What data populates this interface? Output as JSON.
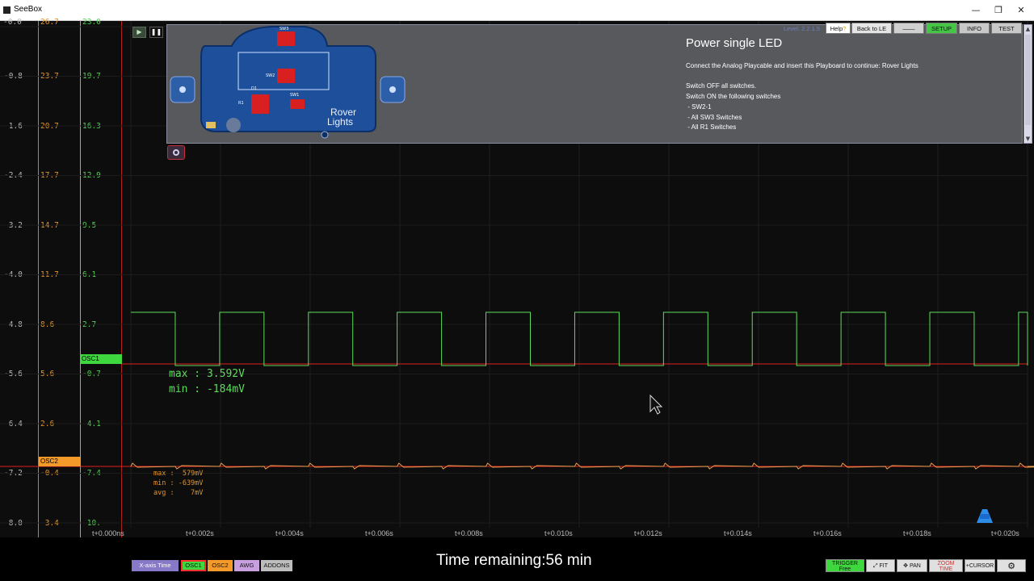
{
  "window": {
    "title": "SeeBox",
    "controls": [
      "—",
      "❐",
      "✕"
    ]
  },
  "axes": {
    "col1": [
      "-0.8",
      "-1.6",
      "-2.4",
      "-3.2",
      "-4.0",
      "-4.8",
      "-5.6",
      "-6.4",
      "-7.2",
      "-8.0"
    ],
    "col2": [
      "23.7",
      "20.7",
      "17.7",
      "14.7",
      "11.7",
      "8.6",
      "5.6",
      "2.6",
      "-0.4",
      "-3.4"
    ],
    "col3": [
      "19.7",
      "16.3",
      "12.9",
      "9.5",
      "6.1",
      "2.7",
      "-0.7",
      "-4.1",
      "-7.4",
      "-10."
    ],
    "top_partial": {
      "col1": "-0.0",
      "col2": "26.7",
      "col3": "23.0"
    },
    "x_ticks": [
      "t+0.000ns",
      "t+0.002s",
      "t+0.004s",
      "t+0.006s",
      "t+0.008s",
      "t+0.010s",
      "t+0.012s",
      "t+0.014s",
      "t+0.016s",
      "t+0.018s",
      "t+0.020s"
    ]
  },
  "channels": {
    "osc1": {
      "label": "OSC1",
      "color": "#5edc5e",
      "max": "max : 3.592V",
      "min": "min : -184mV"
    },
    "osc2": {
      "label": "OSC2",
      "color": "#f39a2b",
      "max": "max :  579mV",
      "min": "min : -639mV",
      "avg": "avg :    7mV"
    }
  },
  "signal": {
    "period_s": 0.00198,
    "high_fraction": 0.5,
    "osc1_high_V": 3.592,
    "osc1_low_V": -0.184
  },
  "panel": {
    "title": "Power single LED",
    "level": "Level: 2.2.1.5",
    "lines": [
      "Connect the Analog Playcable and insert this Playboard to continue: Rover Lights",
      "",
      "Switch OFF all switches.",
      "Switch ON the following switches",
      " - SW2-1",
      " - All SW3 Switches",
      " - All R1 Switches"
    ],
    "board": {
      "name_line1": "Rover",
      "name_line2": "Lights",
      "labels": [
        "SW3",
        "SW2",
        "D1",
        "SW1",
        "R1"
      ]
    }
  },
  "top_buttons": {
    "help": "Help",
    "back": "Back to LE",
    "dash": "——",
    "setup": "SETUP",
    "info": "INFO",
    "test": "TEST"
  },
  "bottom": {
    "tabs": [
      "X-axis Time",
      "OSC1",
      "OSC2",
      "AWG",
      "ADDONS"
    ],
    "remaining": "Time remaining:56 min",
    "tools": {
      "trigger": "TRIGGER",
      "trigger_sub": "Free",
      "fit": "FIT",
      "pan": "PAN",
      "zoom": "ZOOM",
      "zoom_sub": "TIME",
      "cursor": "CURSOR"
    }
  },
  "colors": {
    "setup": "#45c545",
    "osc1_tab": "#3ed83e",
    "osc2_tab": "#f39a2b",
    "xaxis_tab": "#8878c8",
    "awg_tab": "#c8a0e0",
    "addons_tab": "#bdbdbd",
    "ref_line": "#e02020"
  }
}
